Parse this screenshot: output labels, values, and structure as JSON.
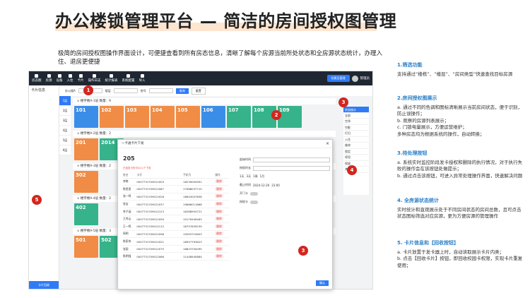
{
  "header": {
    "title": "办公楼锁管理平台 — 简洁的房间授权图管理"
  },
  "intro": "极简的房间授权图操作界面设计，可便捷查看到所有房态信息，清晰了解每个房源当前所处状态和全房源状态统计，办理入住、退房更便捷",
  "app": {
    "nav": [
      "房态图",
      "房源",
      "设备",
      "入住",
      "卡片",
      "操作日志",
      "统计报表",
      "系统配置",
      "导入"
    ],
    "manage_btn": "切换至管理",
    "user": "管理员",
    "left_label": "卡片信息",
    "left_footer": "卡片回收",
    "filter": {
      "building": "办公楼A",
      "floor": "楼层",
      "room": "房号",
      "query": "查询",
      "reset": "重置"
    },
    "floors": [
      "1层",
      "2层",
      "3层",
      "4层",
      "5层",
      "6层"
    ],
    "groups": [
      {
        "header": "∨ 楼宇楼A-1层  数量：9",
        "rooms": [
          {
            "no": "101",
            "color": "c-blue"
          },
          {
            "no": "102",
            "color": "c-orange"
          },
          {
            "no": "103",
            "color": "c-orange"
          },
          {
            "no": "104",
            "color": "c-orange"
          },
          {
            "no": "105",
            "color": "c-orange"
          },
          {
            "no": "106",
            "color": "c-blue"
          },
          {
            "no": "107",
            "color": "c-green"
          },
          {
            "no": "108",
            "color": "c-green"
          },
          {
            "no": "109",
            "color": "c-green"
          }
        ]
      },
      {
        "header": "∨ 楼宇楼A-2层  数量：2",
        "rooms": [
          {
            "no": "201",
            "color": "c-orange"
          },
          {
            "no": "2014",
            "color": "c-green"
          }
        ]
      },
      {
        "header": "∨ 楼宇楼A-3层  数量：2",
        "rooms": [
          {
            "no": "302",
            "color": "c-orange"
          }
        ]
      },
      {
        "header": "∨ 楼宇楼A-4层  数量：2",
        "rooms": [
          {
            "no": "402",
            "color": "c-green"
          }
        ]
      },
      {
        "header": "∨ 楼宇楼A-5层  数量：3",
        "rooms": [
          {
            "no": "501",
            "color": "c-orange"
          },
          {
            "no": "502",
            "color": "c-green"
          }
        ]
      }
    ],
    "status_panel": {
      "title": "房态统计",
      "items": [
        "全部",
        "空净",
        "空脏",
        "打扫",
        "入住",
        "维修",
        "锁定",
        "停用",
        "保留",
        "其他"
      ]
    },
    "modal": {
      "title": "一卡通卡片下发",
      "room_no": "205",
      "warn": "已选发卡的卡片11个下发",
      "columns": [
        "姓名",
        "卡号",
        "手机号",
        "操作"
      ],
      "rows": [
        [
          "李晓",
          "0007731709012003",
          "18239094991",
          "删除"
        ],
        [
          "陈思思",
          "0007731709012087",
          "17988037710",
          "删除"
        ],
        [
          "张一鸣",
          "0007731709012028",
          "18643007658",
          "删除"
        ],
        [
          "张宝",
          "0007731709012037",
          "19866011868",
          "删除"
        ],
        [
          "李子涵",
          "0007731709012123",
          "18288954721",
          "删除"
        ],
        [
          "王秀云",
          "0007731709012059",
          "15170949463",
          "删除"
        ],
        [
          "王一鸣",
          "0007731709012112",
          "18757839239",
          "删除"
        ],
        [
          "周明",
          "0007731709012098",
          "15093710603",
          "删除"
        ],
        [
          "陈家伟",
          "0007731709012021",
          "18957793823",
          "删除"
        ],
        [
          "张丽",
          "0007731709012070",
          "18823750095",
          "删除"
        ],
        [
          "陈明强",
          "0007731709012086",
          "11448940884",
          "删除"
        ]
      ],
      "form": {
        "start_label": "起始时间",
        "time_label": "授权时长",
        "end_label": "截止时间",
        "end_value": "2024-12-26",
        "end_time": "23:00",
        "d1": "1天",
        "d2": "3天",
        "d3": "1周",
        "d4": "1月",
        "open_label": "开门卡",
        "authorize_label": "授权卡",
        "ok": "确认"
      }
    }
  },
  "badges": [
    "1",
    "2",
    "3",
    "4",
    "5",
    "3"
  ],
  "features": [
    {
      "title": "1.筛选功能",
      "lines": [
        "支持通过“楼栋”、“楼层”、“房间类型”快速查找目标房源"
      ]
    },
    {
      "title": "2.房间授权图展示",
      "lines": [
        "a. 通过不同的色调和图标清晰展示当前房间状态，便于识别，防止误操作；",
        "b. 观察的房源列表展示；",
        "c. 门锁电量展示，方便运营维护；",
        "多种房态均为根据系统的操作，自动转换；"
      ]
    },
    {
      "title": "3.待处理按钮",
      "lines": [
        "a. 系统实时监控阶段发卡授权和删除的执行情况，对于执行失败的操作会在该按钮处做提示；",
        "b. 通过点击该按钮，可进入异常处理操作界面，快速解决问题"
      ]
    },
    {
      "title": "4. 全房源状态统计",
      "lines": [
        "实时统计和直观展示处于不同房间状态的房间总数，且可点击状态图标筛选对应房源，更为方便房源的管理操作"
      ]
    },
    {
      "title": "5. 卡片信息和【回收按钮】",
      "lines": [
        "a. 卡片放置于发卡器上时，自动读取展示卡片内类；",
        "b. 点击【回收卡片】按钮，即回收校园卡权限，实现卡片重复使用；"
      ]
    }
  ]
}
